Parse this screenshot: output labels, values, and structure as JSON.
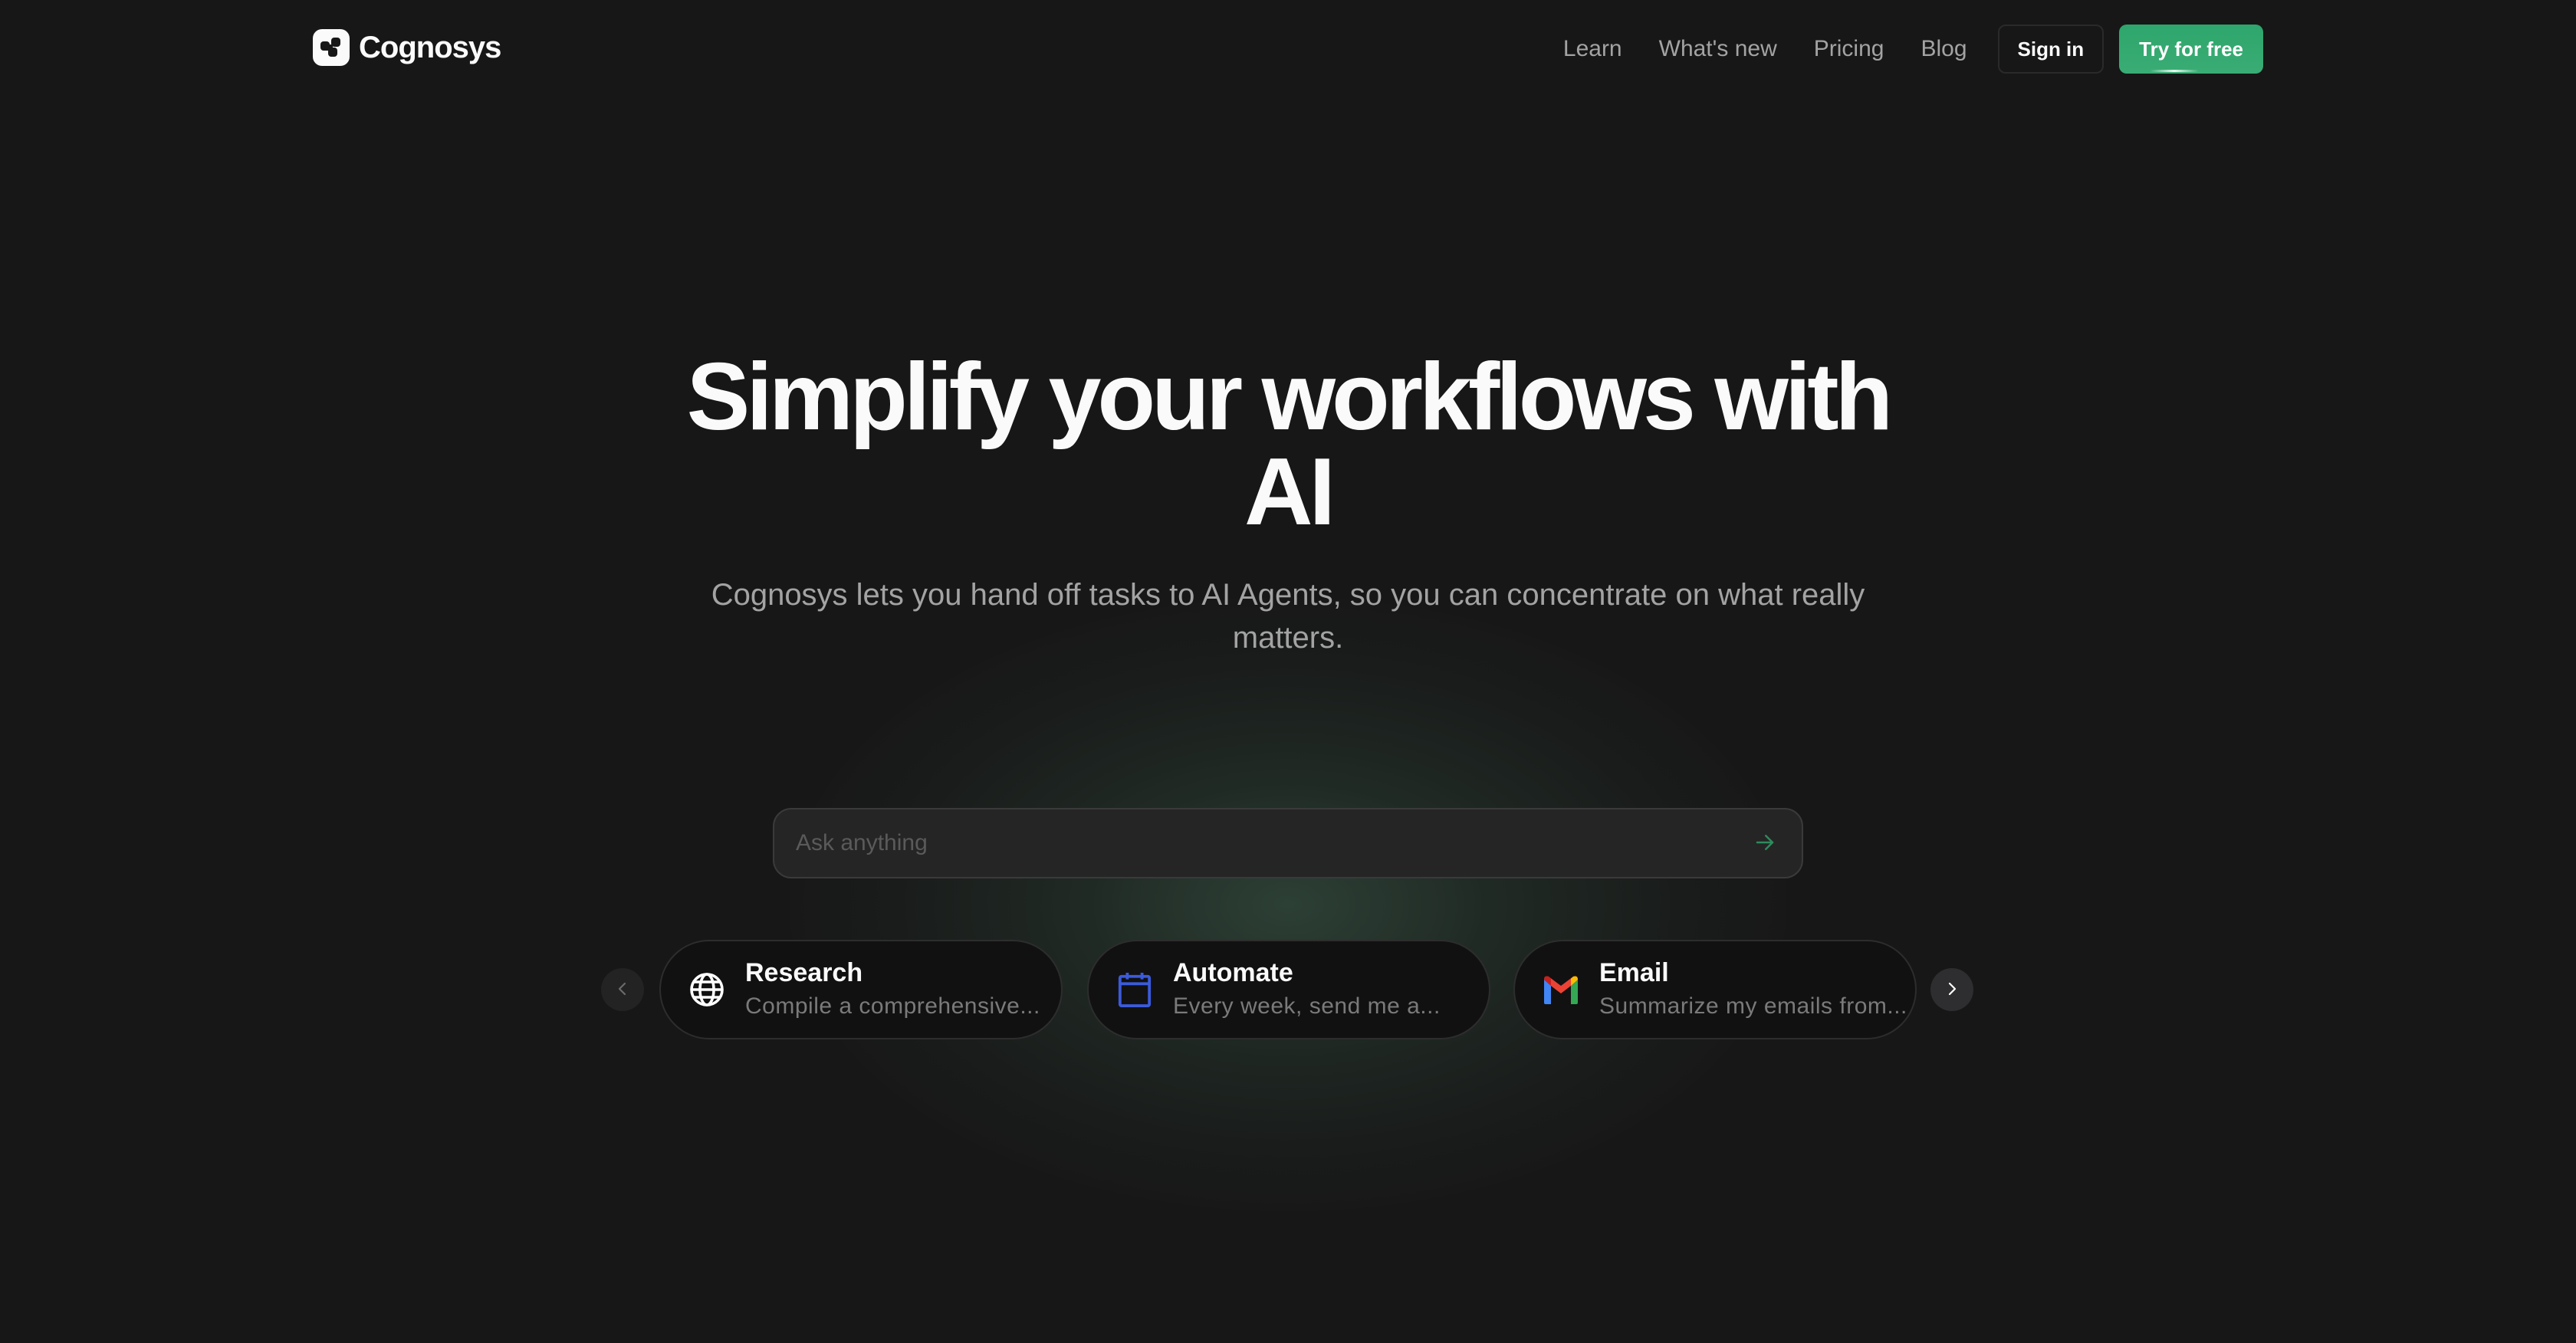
{
  "brand": {
    "name": "Cognosys",
    "accent_color": "#2ea66c"
  },
  "nav": {
    "links": [
      {
        "label": "Learn"
      },
      {
        "label": "What's new"
      },
      {
        "label": "Pricing"
      },
      {
        "label": "Blog"
      }
    ],
    "sign_in_label": "Sign in",
    "try_label": "Try for free"
  },
  "hero": {
    "title_line1": "Simplify your workflows with",
    "title_line2": "AI",
    "subtitle": "Cognosys lets you hand off tasks to AI Agents, so you can concentrate on what really matters."
  },
  "ask": {
    "placeholder": "Ask anything",
    "value": "",
    "send_icon": "arrow-right-icon"
  },
  "carousel": {
    "prev_icon": "chevron-left-icon",
    "next_icon": "chevron-right-icon",
    "cards": [
      {
        "title": "Research",
        "description": "Compile a comprehensive...",
        "icon": "globe-icon",
        "icon_color": "#ffffff"
      },
      {
        "title": "Automate",
        "description": "Every week, send me a...",
        "icon": "calendar-icon",
        "icon_color": "#3b5bdb"
      },
      {
        "title": "Email",
        "description": "Summarize my emails from...",
        "icon": "gmail-icon",
        "icon_color": "#ea4335"
      }
    ]
  }
}
